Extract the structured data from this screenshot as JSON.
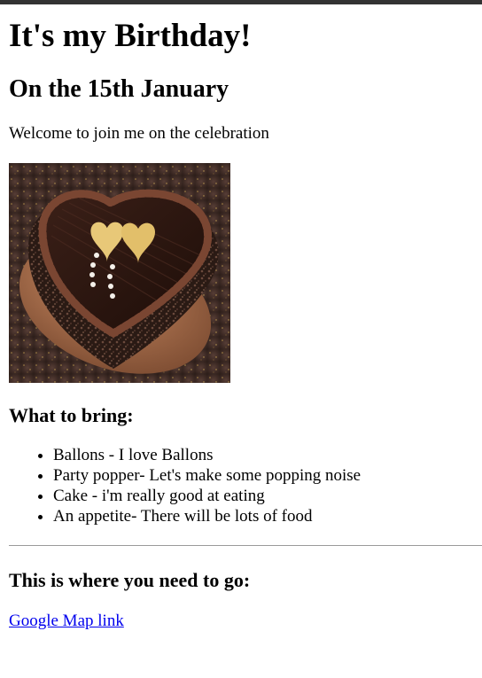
{
  "heading": "It's my Birthday!",
  "subheading": "On the 15th January",
  "welcome": "Welcome to join me on the celebration",
  "bring_heading": "What to bring:",
  "bring_items": [
    "Ballons - I love Ballons",
    "Party popper- Let's make some popping noise",
    "Cake - i'm really good at eating",
    "An appetite- There will be lots of food"
  ],
  "where_heading": "This is where you need to go:",
  "map_link": "Google Map link",
  "colors": {
    "link": "#0000ee",
    "top_bar": "#333333",
    "divider": "#9a9a9a"
  }
}
